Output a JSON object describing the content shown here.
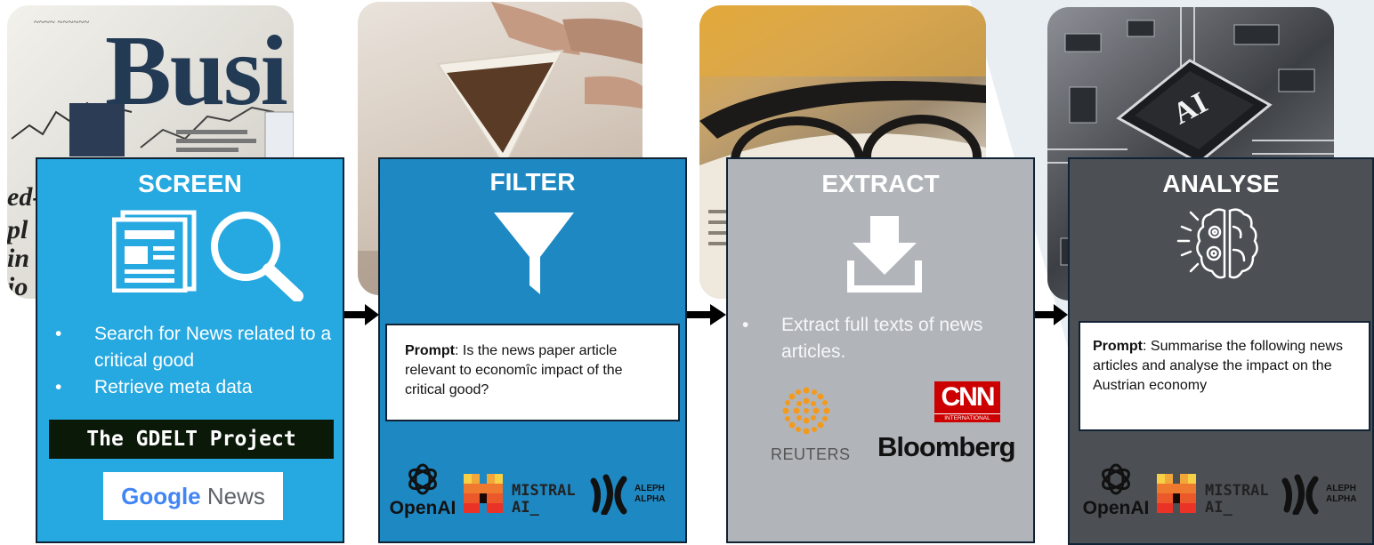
{
  "photo_newspaper": {
    "headline_fragment": "Busi"
  },
  "steps": [
    {
      "title": "SCREEN",
      "bullets": [
        "Search for News related to a critical good",
        "Retrieve meta data"
      ],
      "logos": {
        "gdelt": "The GDELT Project",
        "google_word": "Google",
        "news_word": "News"
      }
    },
    {
      "title": "FILTER",
      "prompt_label": "Prompt",
      "prompt_text": ": Is the news paper article relevant to economîc impact of the critical good?",
      "logos": {
        "openai": "OpenAI",
        "mistral_line1": "MISTRAL",
        "mistral_line2": "AI_",
        "aleph_line1": "ALEPH",
        "aleph_line2": "ALPHA"
      }
    },
    {
      "title": "EXTRACT",
      "bullets": [
        "Extract full texts of news articles."
      ],
      "logos": {
        "reuters": "REUTERS",
        "bloomberg": "Bloomberg",
        "cnn": "CNN",
        "cnn_sub": "INTERNATIONAL"
      }
    },
    {
      "title": "ANALYSE",
      "prompt_label": "Prompt",
      "prompt_text": ": Summarise the following news articles and analyse the impact on the Austrian economy",
      "logos": {
        "openai": "OpenAI",
        "mistral_line1": "MISTRAL",
        "mistral_line2": "AI_",
        "aleph_line1": "ALEPH",
        "aleph_line2": "ALPHA"
      }
    }
  ],
  "colors": {
    "screen": "#26a8e0",
    "filter": "#1e88c2",
    "extract": "#b1b5ba",
    "analyse": "#4c5054",
    "border": "#102233",
    "arrow": "#000000"
  },
  "icons": [
    "newspaper-icon",
    "magnifier-icon",
    "funnel-icon",
    "download-icon",
    "brain-gears-icon"
  ]
}
